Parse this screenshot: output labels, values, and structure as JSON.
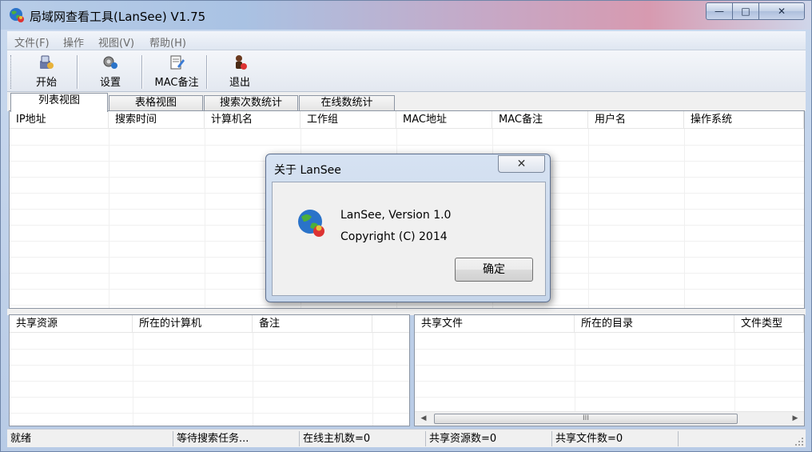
{
  "window": {
    "title": "局域网查看工具(LanSee) V1.75",
    "minimize_glyph": "—",
    "maximize_glyph": "□",
    "close_glyph": "✕"
  },
  "menu": {
    "items": [
      {
        "label": "文件(F)"
      },
      {
        "label": "操作"
      },
      {
        "label": "视图(V)"
      },
      {
        "label": "帮助(H)"
      }
    ]
  },
  "toolbar": {
    "buttons": [
      {
        "label": "开始",
        "icon": "start-icon"
      },
      {
        "label": "设置",
        "icon": "settings-icon"
      },
      {
        "label": "MAC备注",
        "icon": "mac-note-icon"
      },
      {
        "label": "退出",
        "icon": "exit-icon"
      }
    ]
  },
  "tabs": [
    {
      "label": "列表视图",
      "active": true
    },
    {
      "label": "表格视图",
      "active": false
    },
    {
      "label": "搜索次数统计",
      "active": false
    },
    {
      "label": "在线数统计",
      "active": false
    }
  ],
  "main_list": {
    "columns": [
      "IP地址",
      "搜索时间",
      "计算机名",
      "工作组",
      "MAC地址",
      "MAC备注",
      "用户名",
      "操作系统"
    ]
  },
  "shares_list": {
    "columns": [
      "共享资源",
      "所在的计算机",
      "备注"
    ]
  },
  "files_list": {
    "columns": [
      "共享文件",
      "所在的目录",
      "文件类型"
    ],
    "scroll_left": "◀",
    "scroll_right": "▶",
    "thumb_grip": "III"
  },
  "status": {
    "cells": [
      "就绪",
      "等待搜索任务...",
      "在线主机数=0",
      "共享资源数=0",
      "共享文件数=0"
    ]
  },
  "dialog": {
    "title": "关于 LanSee",
    "close_glyph": "✕",
    "line1": "LanSee, Version 1.0",
    "line2": "Copyright (C) 2014",
    "ok_label": "确定"
  }
}
